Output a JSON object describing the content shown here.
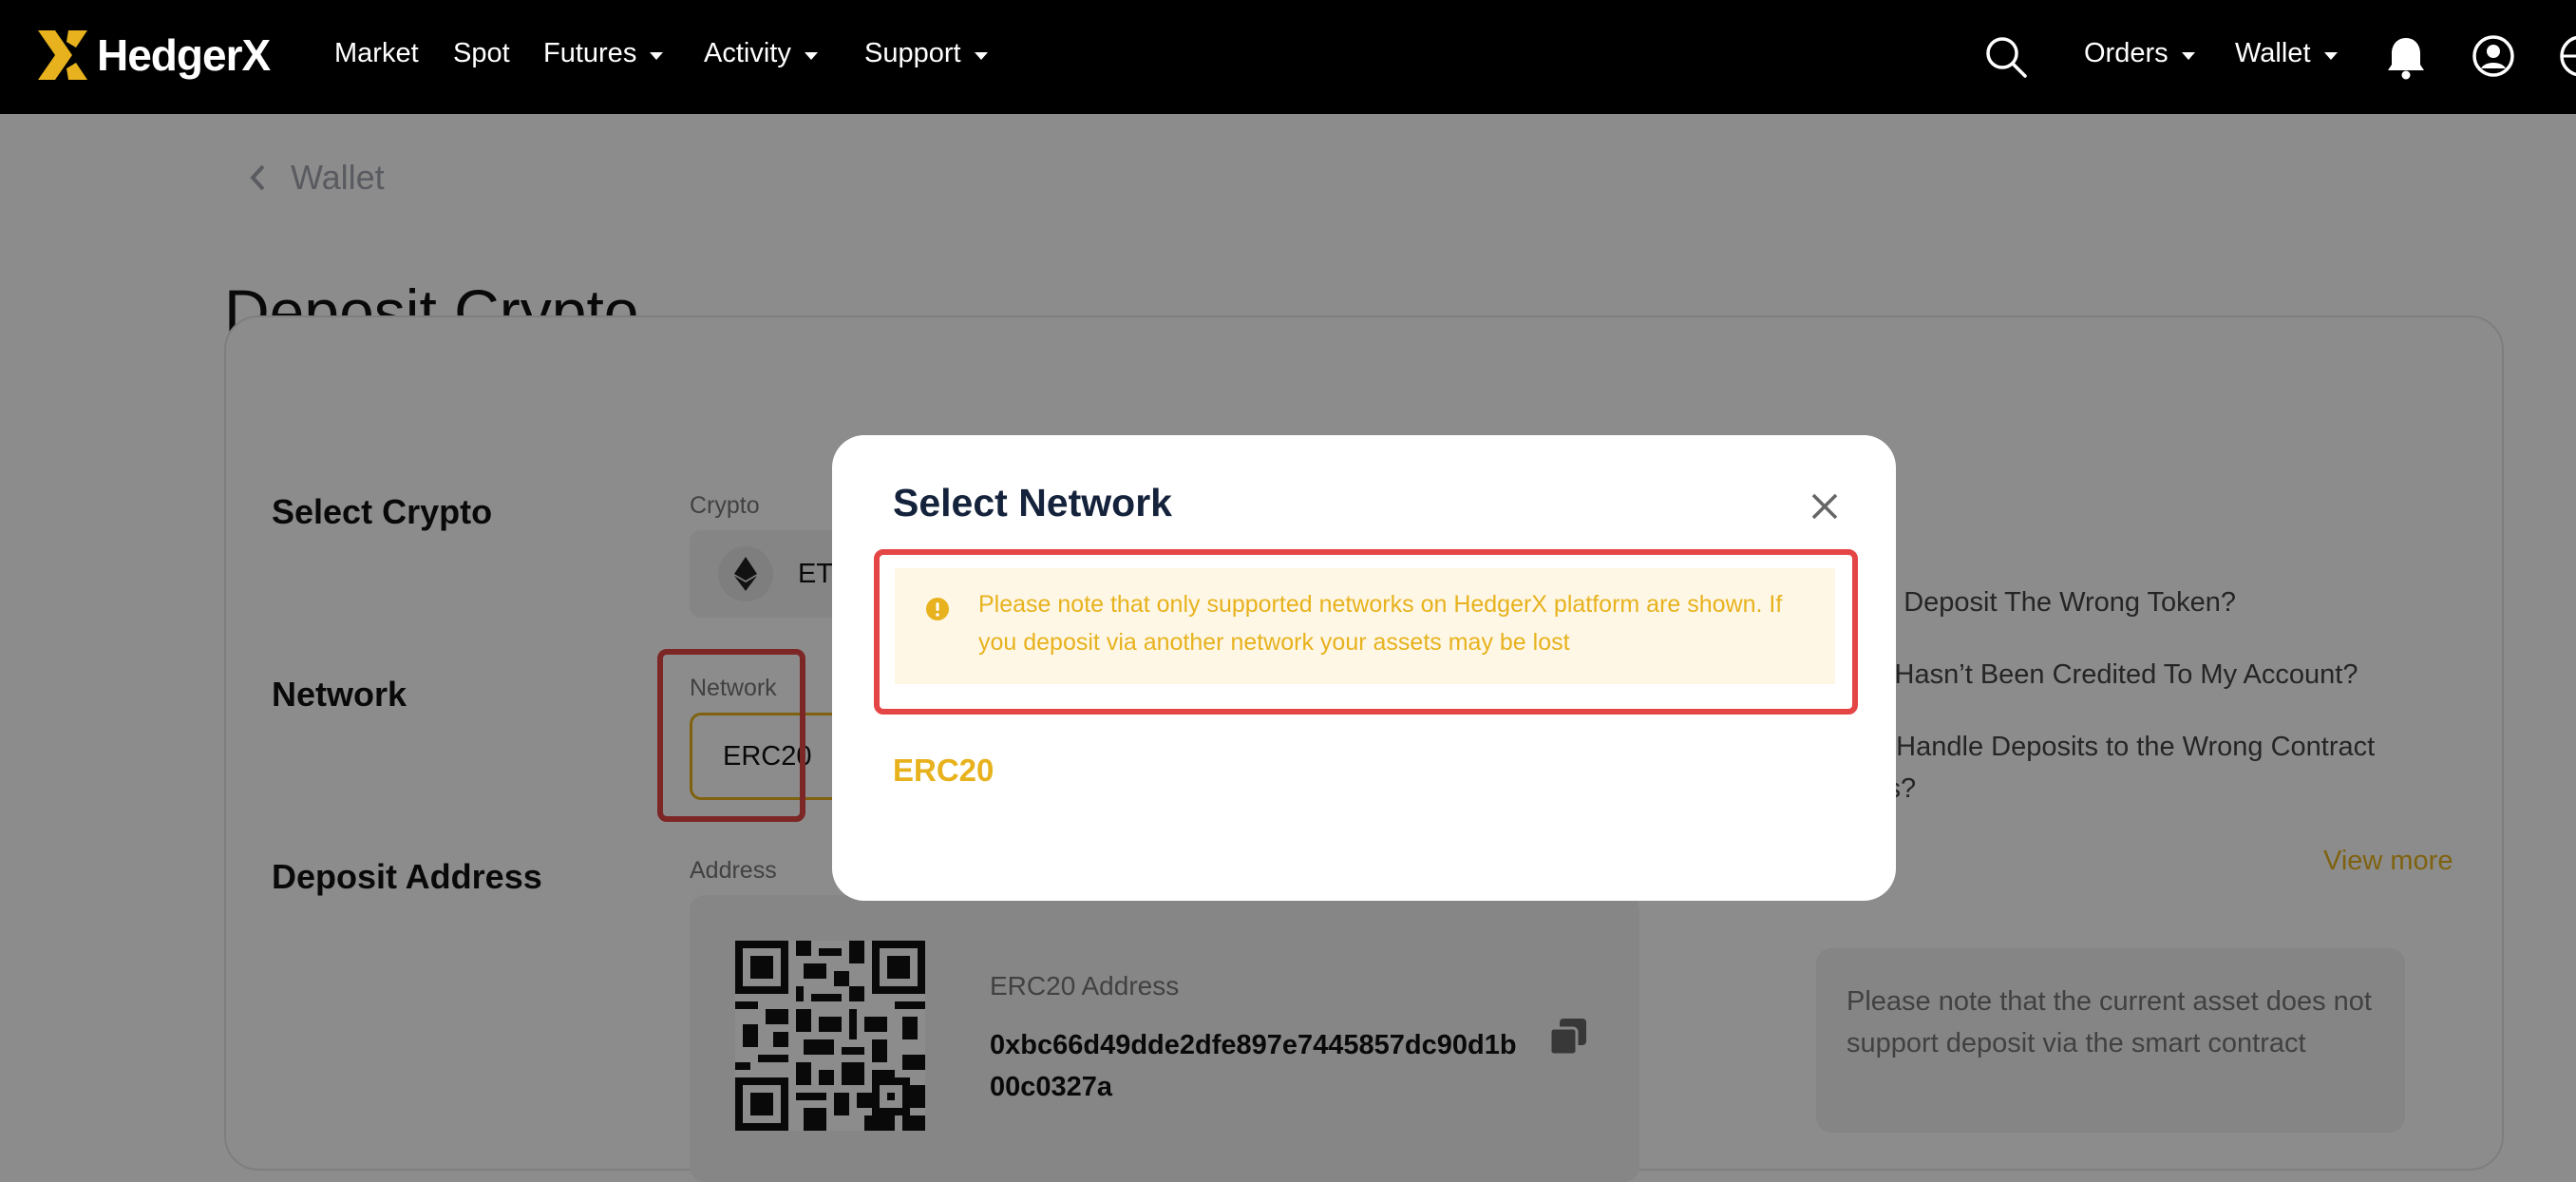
{
  "brand": {
    "name": "HedgerX",
    "accent": "#e7b21d",
    "warning": "#e7b21d",
    "annotation": "#e44646"
  },
  "nav": {
    "items": [
      {
        "label": "Market",
        "dropdown": false
      },
      {
        "label": "Spot",
        "dropdown": false
      },
      {
        "label": "Futures",
        "dropdown": true
      },
      {
        "label": "Activity",
        "dropdown": true
      },
      {
        "label": "Support",
        "dropdown": true
      }
    ],
    "right": [
      {
        "label": "Orders",
        "dropdown": true
      },
      {
        "label": "Wallet",
        "dropdown": true
      }
    ],
    "icons": [
      "search-icon",
      "bell-icon",
      "user-icon",
      "globe-icon"
    ]
  },
  "page": {
    "back_label": "Wallet",
    "title": "Deposit Crypto"
  },
  "form": {
    "select_crypto_label": "Select Crypto",
    "crypto_field_label": "Crypto",
    "crypto_value": "ET",
    "network_label": "Network",
    "network_field_label": "Network",
    "network_value": "ERC20",
    "deposit_address_label": "Deposit Address",
    "address_field_label": "Address",
    "erc20_address_label": "ERC20 Address",
    "address_value": "0xbc66d49dde2dfe897e7445857dc90d1b00c0327a"
  },
  "faq": {
    "items": [
      "f I Deposit The Wrong Token?",
      "it Hasn’t Been Credited To My Account?",
      "o Handle Deposits to the Wrong Contract",
      "ss?"
    ],
    "view_more": "View more",
    "notice": "Please note that the current asset does not support deposit via the smart contract"
  },
  "modal": {
    "title": "Select Network",
    "warning": "Please note that only supported networks on HedgerX platform are shown. If you deposit via another network your assets may be lost",
    "options": [
      "ERC20"
    ]
  }
}
